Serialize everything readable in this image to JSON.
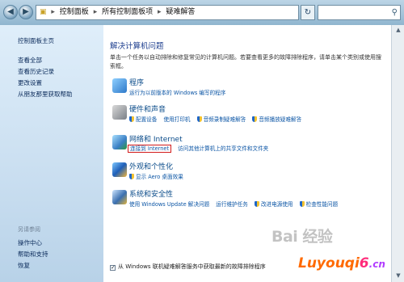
{
  "address_bar": {
    "crumbs": [
      "控制面板",
      "所有控制面板项",
      "疑难解答"
    ],
    "search_placeholder": ""
  },
  "sidebar": {
    "home": "控制面板主页",
    "links": [
      "查看全部",
      "查看历史记录",
      "更改设置",
      "从朋友那里获取帮助"
    ],
    "see_also_title": "另请参阅",
    "see_also": [
      "操作中心",
      "帮助和支持",
      "恢复"
    ]
  },
  "main": {
    "heading": "解决计算机问题",
    "description": "单击一个任务以自动排除和修复常见的计算机问题。若要查看更多的故障排除程序，请单击某个类别或使用搜索框。",
    "categories": [
      {
        "title": "程序",
        "links": [
          "运行为以前版本的 Windows 编写的程序"
        ]
      },
      {
        "title": "硬件和声音",
        "links": [
          "配置设备",
          "使用打印机",
          "音频录制疑难解答",
          "音频播放疑难解答"
        ]
      },
      {
        "title": "网络和 Internet",
        "links": [
          "连接到 Internet",
          "访问其他计算机上的共享文件和文件夹"
        ]
      },
      {
        "title": "外观和个性化",
        "links": [
          "显示 Aero 桌面效果"
        ]
      },
      {
        "title": "系统和安全性",
        "links": [
          "使用 Windows Update 解决问题",
          "运行维护任务",
          "改进电源使用",
          "检查性能问题"
        ]
      }
    ],
    "footer_checkbox": "从 Windows 联机疑难解答服务中获取最新的故障排除程序"
  },
  "watermark": {
    "brand": "Bai 经验",
    "site_a": "Luyouqi",
    "site_b": "6",
    "site_c": ".cn"
  },
  "colors": {
    "highlight_border": "#d21a1a",
    "link": "#0b55a5",
    "category_title": "#0b4c8a"
  }
}
